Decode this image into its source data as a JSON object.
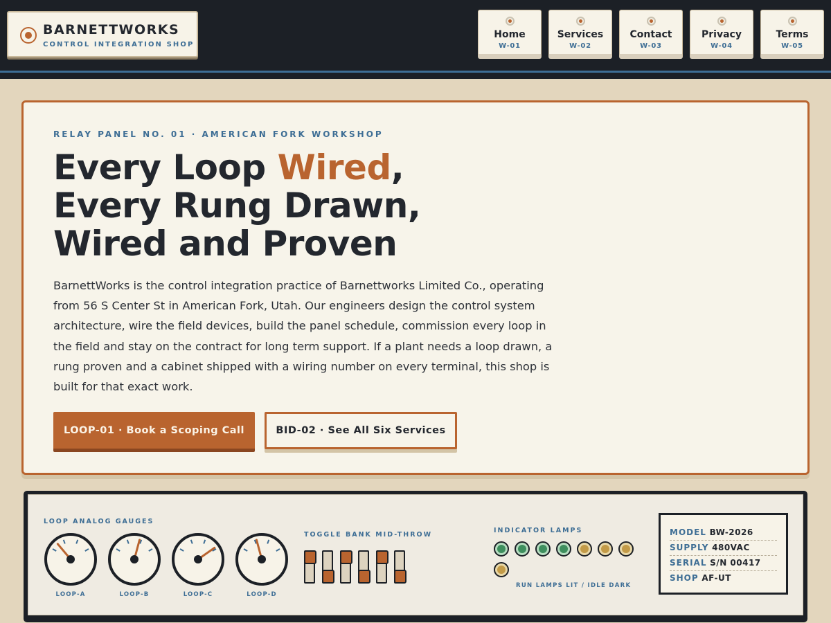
{
  "brand": {
    "name": "BARNETTWORKS",
    "subtitle": "CONTROL INTEGRATION SHOP"
  },
  "nav": [
    {
      "label": "Home",
      "code": "W-01"
    },
    {
      "label": "Services",
      "code": "W-02"
    },
    {
      "label": "Contact",
      "code": "W-03"
    },
    {
      "label": "Privacy",
      "code": "W-04"
    },
    {
      "label": "Terms",
      "code": "W-05"
    }
  ],
  "hero": {
    "eyebrow": "RELAY PANEL NO. 01 · AMERICAN FORK WORKSHOP",
    "headline_before": "Every Loop ",
    "headline_accent": "Wired",
    "headline_after": ", Every Rung Drawn, Wired and Proven",
    "lede": "BarnettWorks is the control integration practice of Barnettworks Limited Co., operating from 56 S Center St in American Fork, Utah. Our engineers design the control system architecture, wire the field devices, build the panel schedule, commission every loop in the field and stay on the contract for long term support. If a plant needs a loop drawn, a rung proven and a cabinet shipped with a wiring number on every terminal, this shop is built for that exact work.",
    "primary_cta": "LOOP-01 · Book a Scoping Call",
    "secondary_cta": "BID-02 · See All Six Services"
  },
  "panel": {
    "gauges_label": "LOOP ANALOG GAUGES",
    "gauges": [
      {
        "label": "LOOP-A",
        "needle_angle_deg": -40
      },
      {
        "label": "LOOP-B",
        "needle_angle_deg": 15
      },
      {
        "label": "LOOP-C",
        "needle_angle_deg": 55
      },
      {
        "label": "LOOP-D",
        "needle_angle_deg": -15
      }
    ],
    "toggles_label": "TOGGLE BANK MID-THROW",
    "toggles": [
      "up",
      "down",
      "up",
      "down",
      "up",
      "down"
    ],
    "lamps_label": "INDICATOR LAMPS",
    "lamps": [
      "run",
      "run",
      "run",
      "run",
      "idle",
      "idle",
      "idle",
      "idle"
    ],
    "lamps_caption": "RUN LAMPS LIT / IDLE DARK",
    "plate": [
      {
        "key": "MODEL",
        "value": "BW-2026"
      },
      {
        "key": "SUPPLY",
        "value": "480VAC"
      },
      {
        "key": "SERIAL",
        "value": "S/N 00417"
      },
      {
        "key": "SHOP",
        "value": "AF-UT"
      }
    ]
  },
  "colors": {
    "accent": "#b9642f",
    "blue": "#3e6e95",
    "dark": "#1c2026",
    "paper": "#f7f4ea",
    "run_lamp": "#3e8f5e",
    "idle_lamp": "#c39b48"
  }
}
